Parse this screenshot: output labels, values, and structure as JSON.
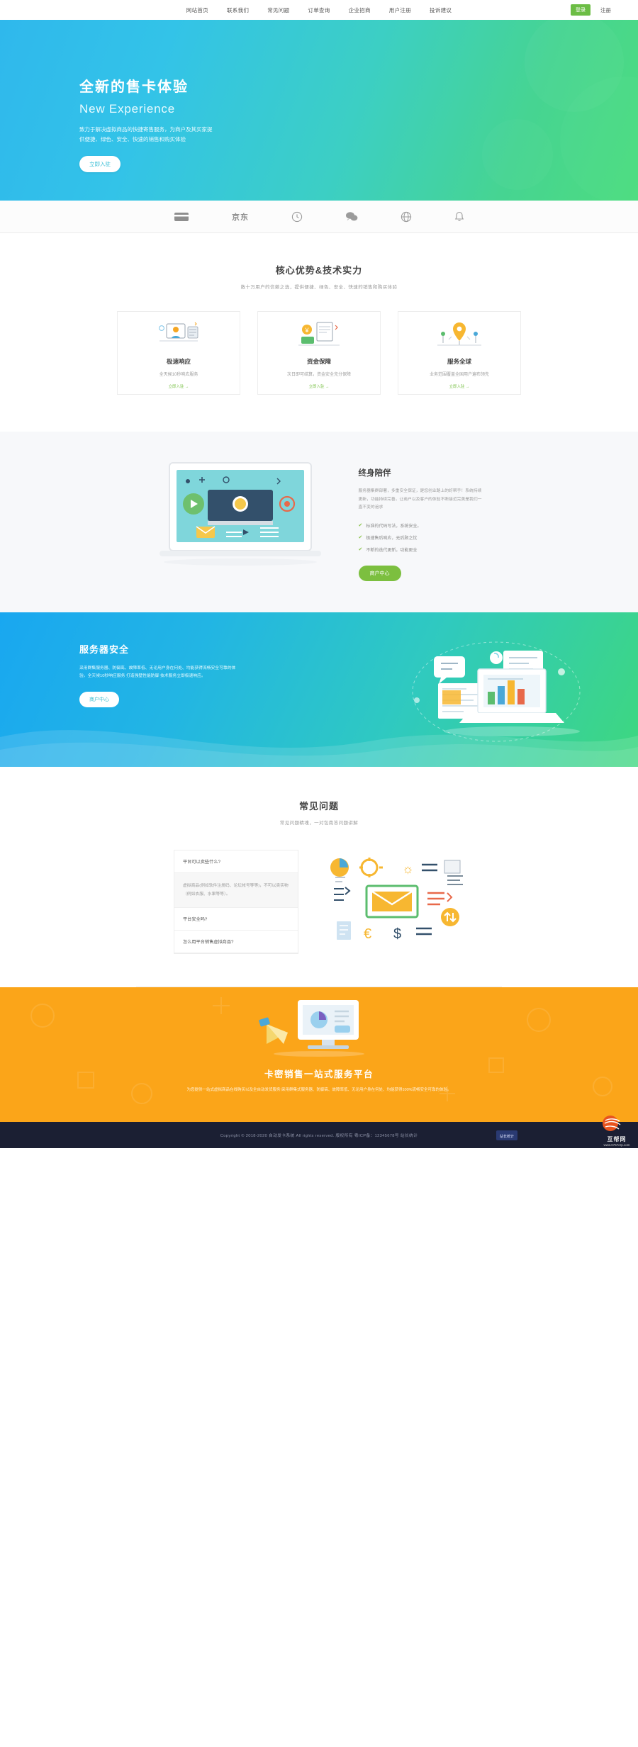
{
  "topbar": {
    "nav": [
      {
        "label": "网站首页"
      },
      {
        "label": "联系我们"
      },
      {
        "label": "常见问题"
      },
      {
        "label": "订单查询"
      },
      {
        "label": "企业招商"
      },
      {
        "label": "用户注册"
      },
      {
        "label": "投诉建议"
      }
    ],
    "login_label": "登录",
    "register_label": "注册"
  },
  "hero": {
    "title_cn": "全新的售卡体验",
    "title_en": "New Experience",
    "desc": "致力于解决虚拟商品的快捷寄售服务，为商户及其买家提供便捷、绿色、安全、快速的销售和购买体验",
    "cta_label": "立即入驻",
    "gradient_from": "#2fb8ec",
    "gradient_to": "#4ddc7f"
  },
  "brands": [
    {
      "name": "alipay-icon",
      "label": ""
    },
    {
      "name": "jingdong-logo",
      "label": "京东"
    },
    {
      "name": "clock-icon",
      "label": ""
    },
    {
      "name": "wechat-icon",
      "label": ""
    },
    {
      "name": "globe-icon",
      "label": ""
    },
    {
      "name": "bell-icon",
      "label": ""
    }
  ],
  "advantages": {
    "title": "核心优势&技术实力",
    "subtitle": "数十万用户的信赖之选，提供便捷、绿色、安全、快速的销售和购买体验",
    "cards": [
      {
        "title": "极速响应",
        "desc": "全天候10秒响应服务",
        "link": "立即入驻 →"
      },
      {
        "title": "资金保障",
        "desc": "次日即可结算，资金安全充分保障",
        "link": "立即入驻 →"
      },
      {
        "title": "服务全球",
        "desc": "业务范围覆盖全国用户遍布领先",
        "link": "立即入驻 →"
      }
    ],
    "link_color": "#7cc24a"
  },
  "companion": {
    "title": "终身陪伴",
    "desc": "服务器集群部署，多重安全保证，是您创业路上的好帮手！系统持续更新，功能持续完善，让商户以及客户的体验不断接近完美是我们一直不变的追求",
    "bullets": [
      {
        "text": "标准的代码写法，系统安全。"
      },
      {
        "text": "极速售后响应，无后顾之忧"
      },
      {
        "text": "不断的迭代更新，功能更全"
      }
    ],
    "cta_label": "商户中心",
    "cta_color": "#7cbf3f"
  },
  "security": {
    "title": "服务器安全",
    "desc": "采用群集服务器、防御高、故障率低、无论用户身在何处、均能获得流畅安全可靠的体验。全天候10秒响应服务 打造强壁性能防御 技术服务立即极速响应。",
    "cta_label": "商户中心"
  },
  "faq": {
    "title": "常见问题",
    "subtitle": "常见问题精魂，一对包南答问题讲解",
    "items": [
      {
        "q": "平台可以卖些什么?",
        "a": "虚拟商品(例如软件注册码、论坛帐号等等)，不可以卖实物（例如衣服、水果等等）。",
        "open": true
      },
      {
        "q": "平台安全吗?",
        "a": "",
        "open": false
      },
      {
        "q": "怎么用平台销售虚拟商品?",
        "a": "",
        "open": false
      }
    ]
  },
  "cta": {
    "title": "卡密销售一站式服务平台",
    "desc": "为您提供一站式虚拟商品在线购买以及全自动发货服务!采用群集式服务器、防御高、故障率低、无论用户身在何处、均能获得100%流畅安全可靠的体验。",
    "bg_color": "#fba519"
  },
  "footer": {
    "copyright": "Copyright © 2018-2020 自动发卡系统 All rights reserved. 版权所有 粤ICP备：12345678号 站长统计",
    "bg_color": "#1b1f33",
    "watermark_title": "互帮网",
    "watermark_sub": "www.0757erp.com"
  }
}
